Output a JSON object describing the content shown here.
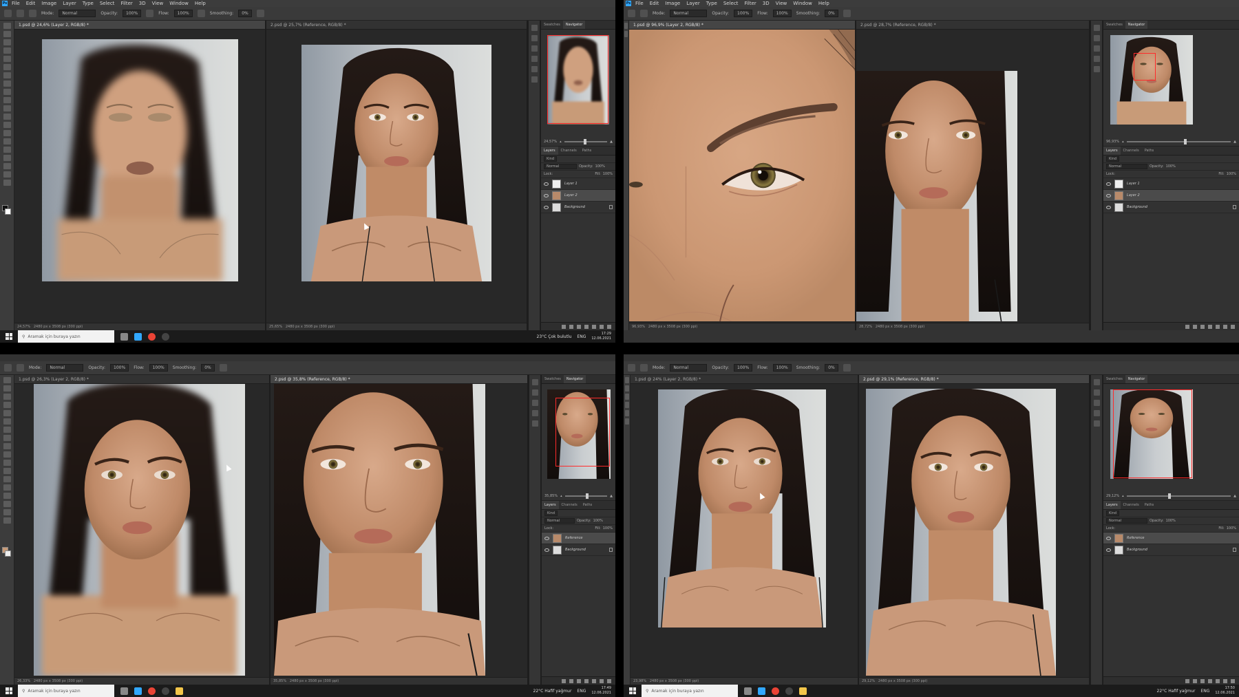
{
  "menu": [
    "File",
    "Edit",
    "Image",
    "Layer",
    "Type",
    "Select",
    "Filter",
    "3D",
    "View",
    "Window",
    "Help"
  ],
  "options": {
    "mode_label": "Mode:",
    "mode": "Normal",
    "opacity_label": "Opacity:",
    "opacity": "100%",
    "flow_label": "Flow:",
    "flow": "100%",
    "smoothing_label": "Smoothing:",
    "smoothing": "0%"
  },
  "panel_tabs": [
    "Swatches",
    "Navigator"
  ],
  "layer_tabs": [
    "Layers",
    "Channels",
    "Paths"
  ],
  "layer_kind": "Kind",
  "layer_mode": "Normal",
  "layer_opacity_label": "Opacity:",
  "layer_opacity": "100%",
  "lock_label": "Lock:",
  "fill_label": "Fill:",
  "fill": "100%",
  "search_placeholder": "Aramak için buraya yazın",
  "colors": {
    "accent": "#31a8ff",
    "nav_box": "#ff2a2a",
    "ui_bg": "#282828",
    "panel": "#323232"
  },
  "q1": {
    "tab_left": "1.psd @ 24,6% (Layer 2, RGB/8) *",
    "tab_right": "2.psd @ 25,7% (Reference, RGB/8) *",
    "zoom_left": "24,57%",
    "status_left": "2480 px x 3508 px (300 ppi)",
    "zoom_right": "25,65%",
    "status_right": "2480 px x 3508 px (300 ppi)",
    "nav_zoom": "24,57%",
    "layers": [
      {
        "name": "Layer 1"
      },
      {
        "name": "Layer 2"
      },
      {
        "name": "Background"
      }
    ],
    "weather": "23°C  Çok bulutlu",
    "lang": "ENG",
    "time": "17:29",
    "date": "12.06.2021"
  },
  "q2": {
    "tab_left": "1.psd @ 96,9% (Layer 2, RGB/8) *",
    "tab_right": "2.psd @ 28,7% (Reference, RGB/8) *",
    "zoom_left": "96,93%",
    "status_left": "2480 px x 3508 px (300 ppi)",
    "zoom_right": "28,72%",
    "status_right": "2480 px x 3508 px (300 ppi)",
    "nav_zoom": "96,93%",
    "layers": [
      {
        "name": "Layer 1"
      },
      {
        "name": "Layer 2"
      },
      {
        "name": "Background"
      }
    ]
  },
  "q3": {
    "tab_left": "1.psd @ 26,3% (Layer 2, RGB/8) *",
    "tab_right": "2.psd @ 35,8% (Reference, RGB/8) *",
    "zoom_left": "26,33%",
    "status_left": "2480 px x 3508 px (300 ppi)",
    "zoom_right": "35,85%",
    "status_right": "2480 px x 3508 px (300 ppi)",
    "nav_zoom": "35,85%",
    "layers": [
      {
        "name": "Reference"
      },
      {
        "name": "Background"
      }
    ],
    "weather": "22°C  Hafif yağmur",
    "lang": "ENG",
    "time": "17:49",
    "date": "12.06.2021"
  },
  "q4": {
    "tab_left": "1.psd @ 24% (Layer 2, RGB/8) *",
    "tab_right": "2.psd @ 29,1% (Reference, RGB/8) *",
    "zoom_left": "23,98%",
    "status_left": "2480 px x 3508 px (300 ppi)",
    "zoom_right": "29,12%",
    "status_right": "2480 px x 3508 px (300 ppi)",
    "nav_zoom": "29,12%",
    "layers": [
      {
        "name": "Reference"
      },
      {
        "name": "Background"
      }
    ],
    "weather": "22°C  Hafif yağmur",
    "lang": "ENG",
    "time": "17:50",
    "date": "12.06.2021"
  }
}
